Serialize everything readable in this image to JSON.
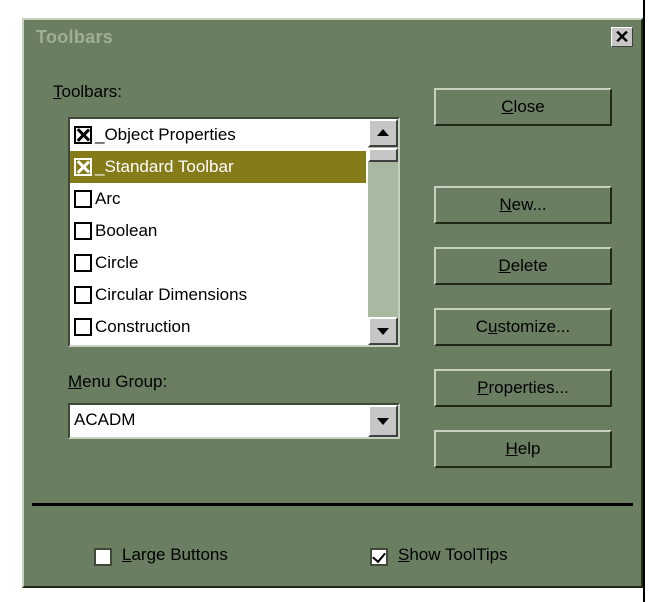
{
  "window": {
    "title": "Toolbars",
    "close_glyph": "✕"
  },
  "toolbars_label": {
    "prefix": "",
    "accel": "T",
    "rest": "oolbars:"
  },
  "toolbar_list": [
    {
      "label": "_Object Properties",
      "checked": true,
      "selected": false
    },
    {
      "label": "_Standard Toolbar",
      "checked": true,
      "selected": true
    },
    {
      "label": "Arc",
      "checked": false,
      "selected": false
    },
    {
      "label": "Boolean",
      "checked": false,
      "selected": false
    },
    {
      "label": "Circle",
      "checked": false,
      "selected": false
    },
    {
      "label": "Circular Dimensions",
      "checked": false,
      "selected": false
    },
    {
      "label": "Construction",
      "checked": false,
      "selected": false
    }
  ],
  "menu_group": {
    "label": {
      "prefix": "",
      "accel": "M",
      "rest": "enu Group:"
    },
    "value": "ACADM"
  },
  "buttons": {
    "close": {
      "prefix": "",
      "accel": "C",
      "rest": "lose"
    },
    "new": {
      "prefix": "",
      "accel": "N",
      "rest": "ew..."
    },
    "delete": {
      "prefix": "",
      "accel": "D",
      "rest": "elete"
    },
    "customize": {
      "prefix": "C",
      "accel": "u",
      "rest": "stomize..."
    },
    "properties": {
      "prefix": "",
      "accel": "P",
      "rest": "roperties..."
    },
    "help": {
      "prefix": "",
      "accel": "H",
      "rest": "elp"
    }
  },
  "options": {
    "large_buttons": {
      "prefix": "",
      "accel": "L",
      "rest": "arge Buttons",
      "checked": false
    },
    "show_tooltips": {
      "prefix": "",
      "accel": "S",
      "rest": "how ToolTips",
      "checked": true
    }
  },
  "colors": {
    "dialog_bg": "#6a7f62",
    "selection": "#857b18",
    "title_text": "#9fae97"
  }
}
